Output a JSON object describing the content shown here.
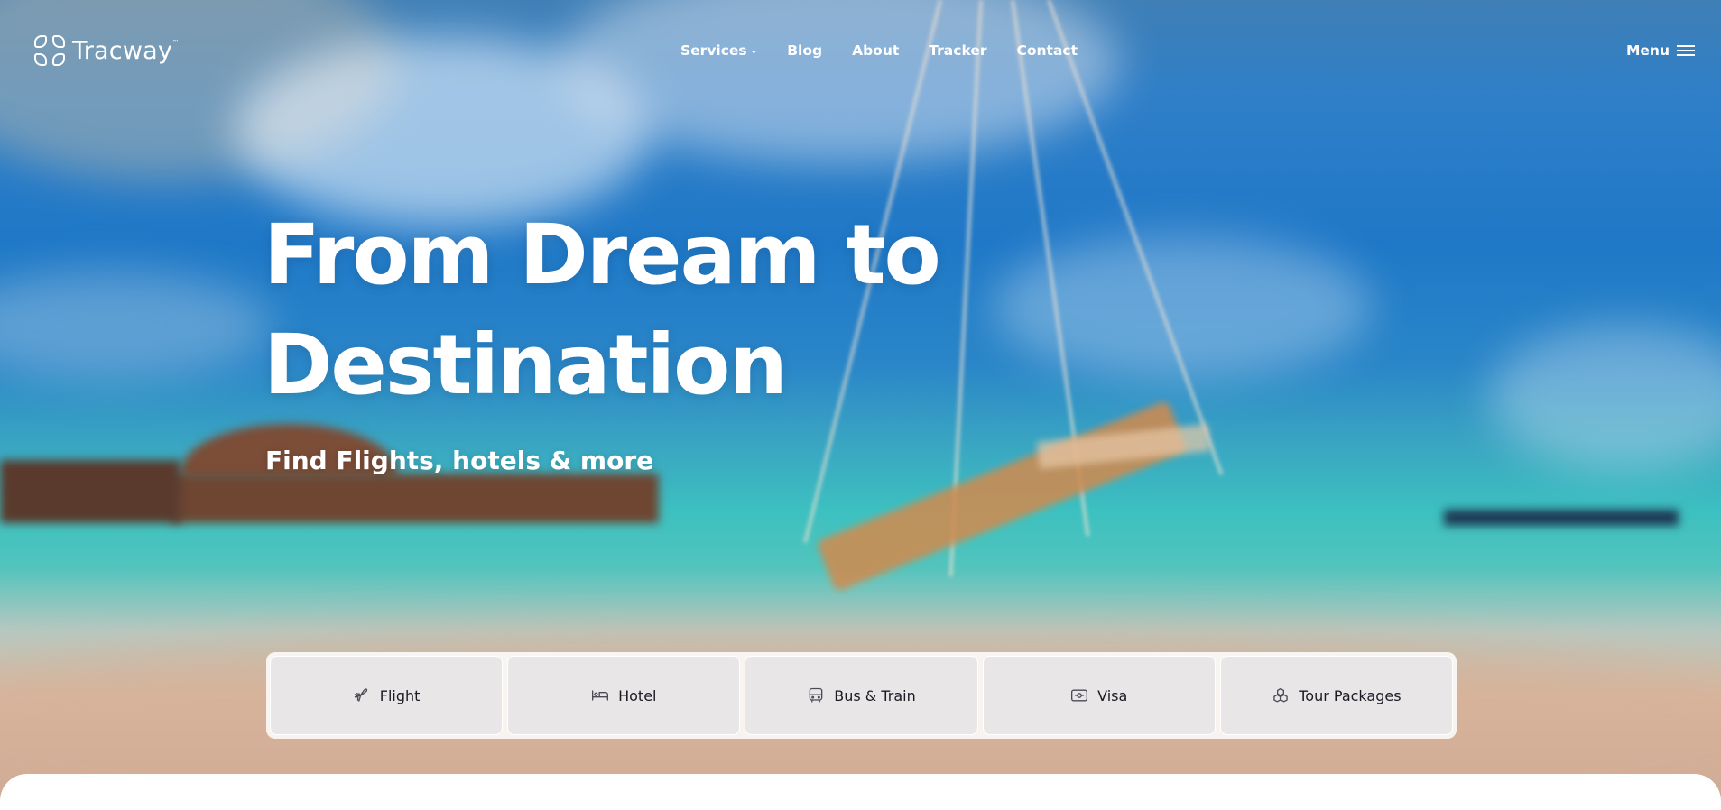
{
  "brand": {
    "name": "Tracway",
    "tm": "™"
  },
  "nav": {
    "items": [
      {
        "label": "Services",
        "has_dropdown": true
      },
      {
        "label": "Blog"
      },
      {
        "label": "About"
      },
      {
        "label": "Tracker"
      },
      {
        "label": "Contact"
      }
    ],
    "menu_label": "Menu"
  },
  "hero": {
    "title_line1": "From Dream to",
    "title_line2": "Destination",
    "subtitle": "Find Flights, hotels & more"
  },
  "tabs": [
    {
      "label": "Flight",
      "icon": "plane-icon"
    },
    {
      "label": "Hotel",
      "icon": "bed-icon"
    },
    {
      "label": "Bus & Train",
      "icon": "bus-icon"
    },
    {
      "label": "Visa",
      "icon": "passport-icon"
    },
    {
      "label": "Tour Packages",
      "icon": "packages-icon"
    }
  ],
  "colors": {
    "text_light": "#ffffff",
    "tab_text": "#1b1b24",
    "tab_bg": "#e8e5e7"
  }
}
